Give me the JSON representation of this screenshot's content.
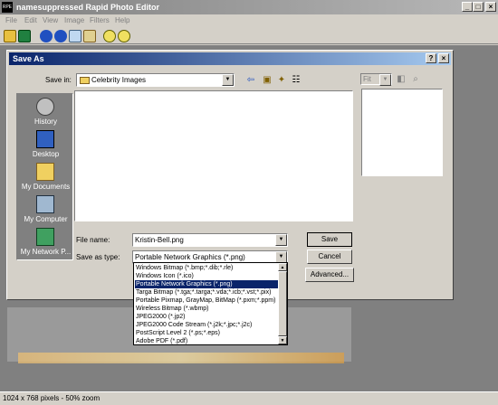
{
  "app": {
    "title": "namesuppressed Rapid Photo Editor",
    "icon_text": "RPE",
    "window_buttons": {
      "minimize": "_",
      "maximize": "□",
      "close": "×"
    },
    "menu": [
      "File",
      "Edit",
      "View",
      "Image",
      "Filters",
      "Help"
    ],
    "toolbar_icons": [
      "open-folder-icon",
      "save-disk-icon",
      "back-circle-icon",
      "forward-circle-icon",
      "copy-icon",
      "paste-icon",
      "zoom-in-icon",
      "zoom-out-icon"
    ],
    "status": "1024 x 768 pixels - 50% zoom"
  },
  "dialog": {
    "title": "Save As",
    "help_btn": "?",
    "close_btn": "×",
    "save_in_label": "Save in:",
    "save_in_value": "Celebrity Images",
    "nav_icons": [
      "back-arrow-icon",
      "up-folder-icon",
      "new-folder-icon",
      "view-menu-icon"
    ],
    "places": [
      "History",
      "Desktop",
      "My Documents",
      "My Computer",
      "My Network P..."
    ],
    "preview_fit": "Fit",
    "file_name_label": "File name:",
    "file_name_value": "Kristin-Bell.png",
    "save_type_label": "Save as type:",
    "save_type_value": "Portable Network Graphics (*.png)",
    "buttons": {
      "save": "Save",
      "cancel": "Cancel",
      "advanced": "Advanced..."
    },
    "type_options": [
      "Windows Bitmap (*.bmp;*.dib;*.rle)",
      "Windows Icon (*.ico)",
      "Portable Network Graphics (*.png)",
      "Targa Bitmap (*.tga;*.targa;*.vda;*.icb;*.vst;*.pix)",
      "Portable Pixmap, GrayMap, BitMap (*.pxm;*.ppm)",
      "Wireless Bitmap (*.wbmp)",
      "JPEG2000 (*.jp2)",
      "JPEG2000 Code Stream (*.j2k;*.jpc;*.j2c)",
      "PostScript Level 2 (*.ps;*.eps)",
      "Adobe PDF (*.pdf)"
    ],
    "selected_option_index": 2
  }
}
